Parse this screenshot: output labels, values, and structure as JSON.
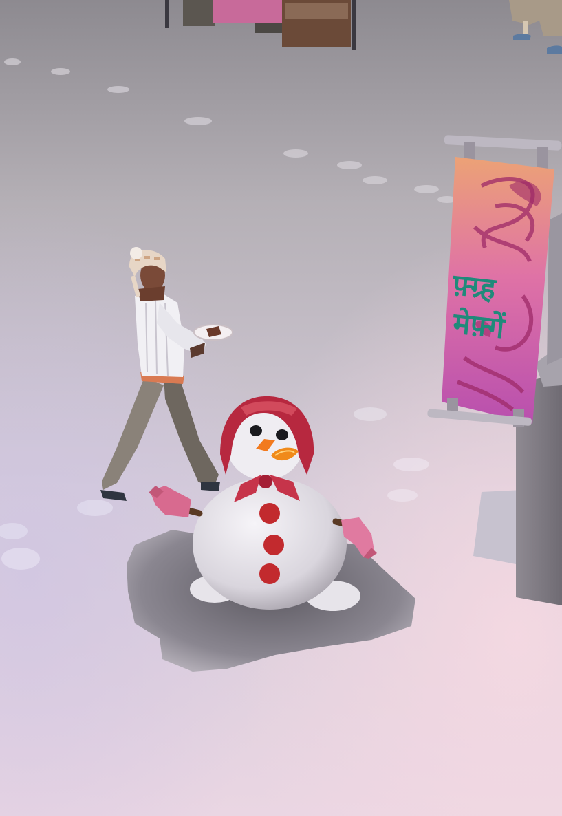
{
  "scene": {
    "banner": {
      "line1": "फ़्ग्र्ह",
      "line2": "मेफ़्गें"
    },
    "colors": {
      "ground_top": "#a9a3a8",
      "ground_bottom": "#ead7e4",
      "banner_pink": "#d35fb0",
      "banner_orange": "#e9a076",
      "scarf_red": "#b7283f",
      "mitten_pink": "#d96d93"
    }
  }
}
